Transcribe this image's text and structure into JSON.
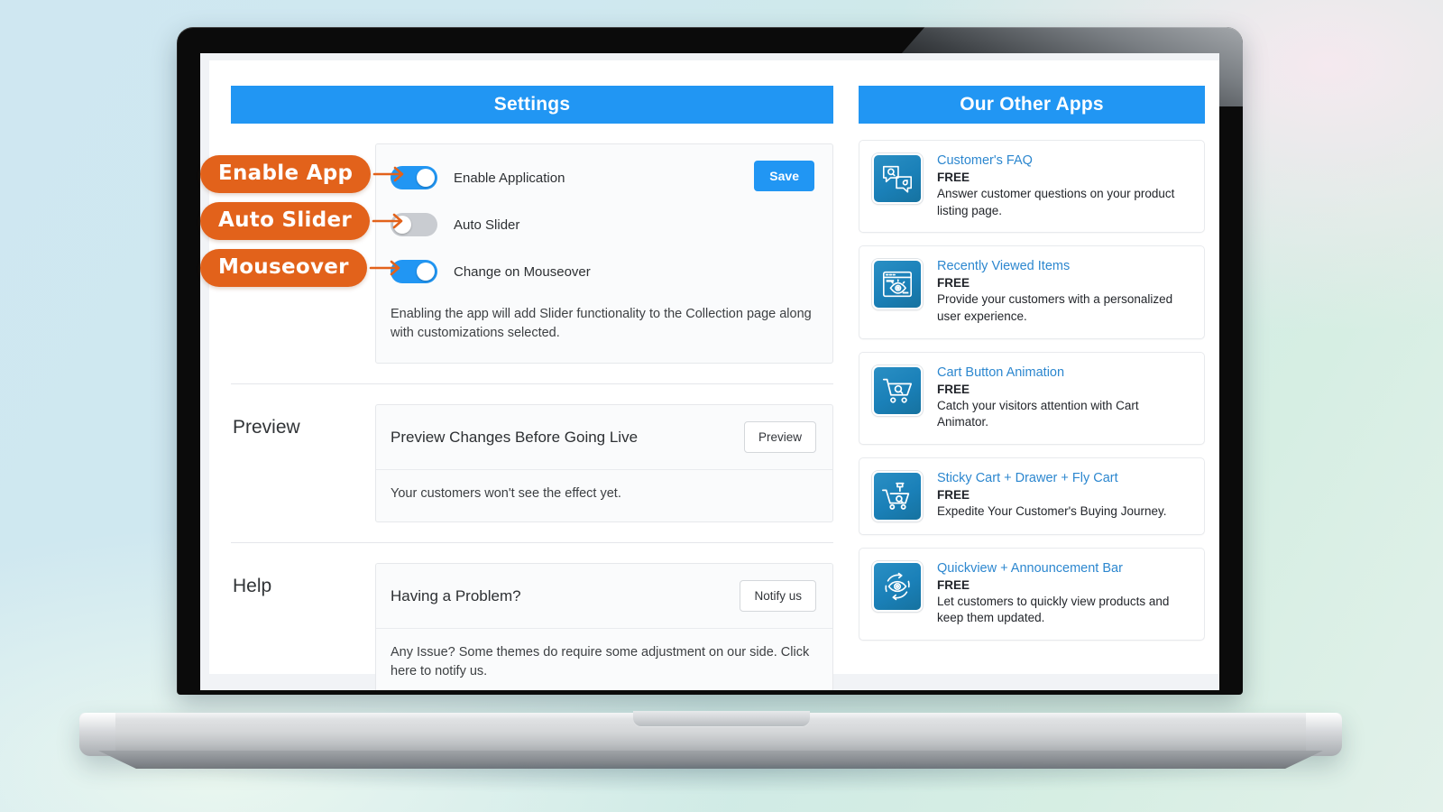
{
  "settings_panel": {
    "header": "Settings",
    "toggles": [
      {
        "label": "Enable Application",
        "state": "on"
      },
      {
        "label": "Auto Slider",
        "state": "off"
      },
      {
        "label": "Change on Mouseover",
        "state": "on"
      }
    ],
    "save_label": "Save",
    "helper_text": "Enabling the app will add Slider functionality to the Collection page along with customizations selected."
  },
  "preview_section": {
    "label": "Preview",
    "title": "Preview Changes Before Going Live",
    "button_label": "Preview",
    "body": "Your customers won't see the effect yet."
  },
  "help_section": {
    "label": "Help",
    "title": "Having a Problem?",
    "button_label": "Notify us",
    "body": "Any Issue? Some themes do require some adjustment on our side. Click here to notify us."
  },
  "apps_panel": {
    "header": "Our Other Apps",
    "items": [
      {
        "name": "Customer's FAQ",
        "price": "FREE",
        "desc": "Answer customer questions on your product listing page.",
        "icon": "qa-speech-bubbles-icon"
      },
      {
        "name": "Recently Viewed Items",
        "price": "FREE",
        "desc": "Provide your customers with a personalized user experience.",
        "icon": "browser-eye-icon"
      },
      {
        "name": "Cart Button Animation",
        "price": "FREE",
        "desc": "Catch your visitors attention with Cart Animator.",
        "icon": "shopping-cart-icon"
      },
      {
        "name": "Sticky Cart + Drawer + Fly Cart",
        "price": "FREE",
        "desc": "Expedite Your Customer's Buying Journey.",
        "icon": "pinned-cart-icon"
      },
      {
        "name": "Quickview + Announcement Bar",
        "price": "FREE",
        "desc": "Let customers to quickly view products and keep them updated.",
        "icon": "eye-refresh-icon"
      }
    ]
  },
  "callouts": [
    {
      "label": "Enable App",
      "icon": "arrow-right-icon"
    },
    {
      "label": "Auto Slider",
      "icon": "arrow-right-icon"
    },
    {
      "label": "Mouseover",
      "icon": "arrow-right-icon"
    }
  ],
  "colors": {
    "accent_blue": "#2196f3",
    "callout_orange": "#e2621b",
    "icon_blue": "#1a80b8",
    "link_blue": "#2c87cf",
    "toggle_off_gray": "#c9ccd1"
  },
  "device": {
    "type": "laptop-mockup"
  }
}
